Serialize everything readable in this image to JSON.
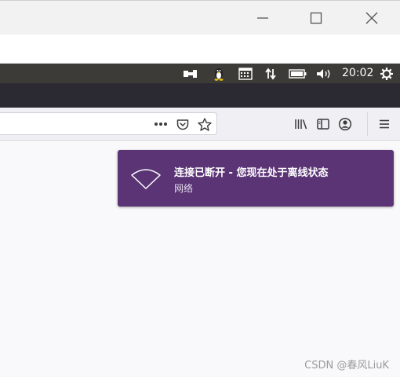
{
  "window": {
    "minimize_icon": "minimize-icon",
    "maximize_icon": "maximize-icon",
    "close_icon": "close-icon"
  },
  "panel": {
    "clock": "20:02",
    "indicators": [
      "power-plug-icon",
      "penguin-icon",
      "calendar-icon",
      "network-transfer-icon",
      "battery-icon",
      "volume-icon",
      "settings-gear-icon"
    ]
  },
  "firefox": {
    "url_actions": [
      "more-dots-icon",
      "pocket-icon",
      "bookmark-star-icon"
    ],
    "toolbar_right": [
      "library-icon",
      "sidebar-icon",
      "account-icon",
      "hamburger-menu-icon"
    ]
  },
  "notification": {
    "title": "连接已断开 - 您现在处于离线状态",
    "subtitle": "网络",
    "icon": "wifi-icon",
    "bg_color": "#5a3475"
  },
  "watermark": "CSDN @春风LiuK",
  "colors": {
    "panel_bg": "#3c3b37",
    "tabstrip_bg": "#2b2a33",
    "toolbar_bg": "#f0f0f4"
  }
}
